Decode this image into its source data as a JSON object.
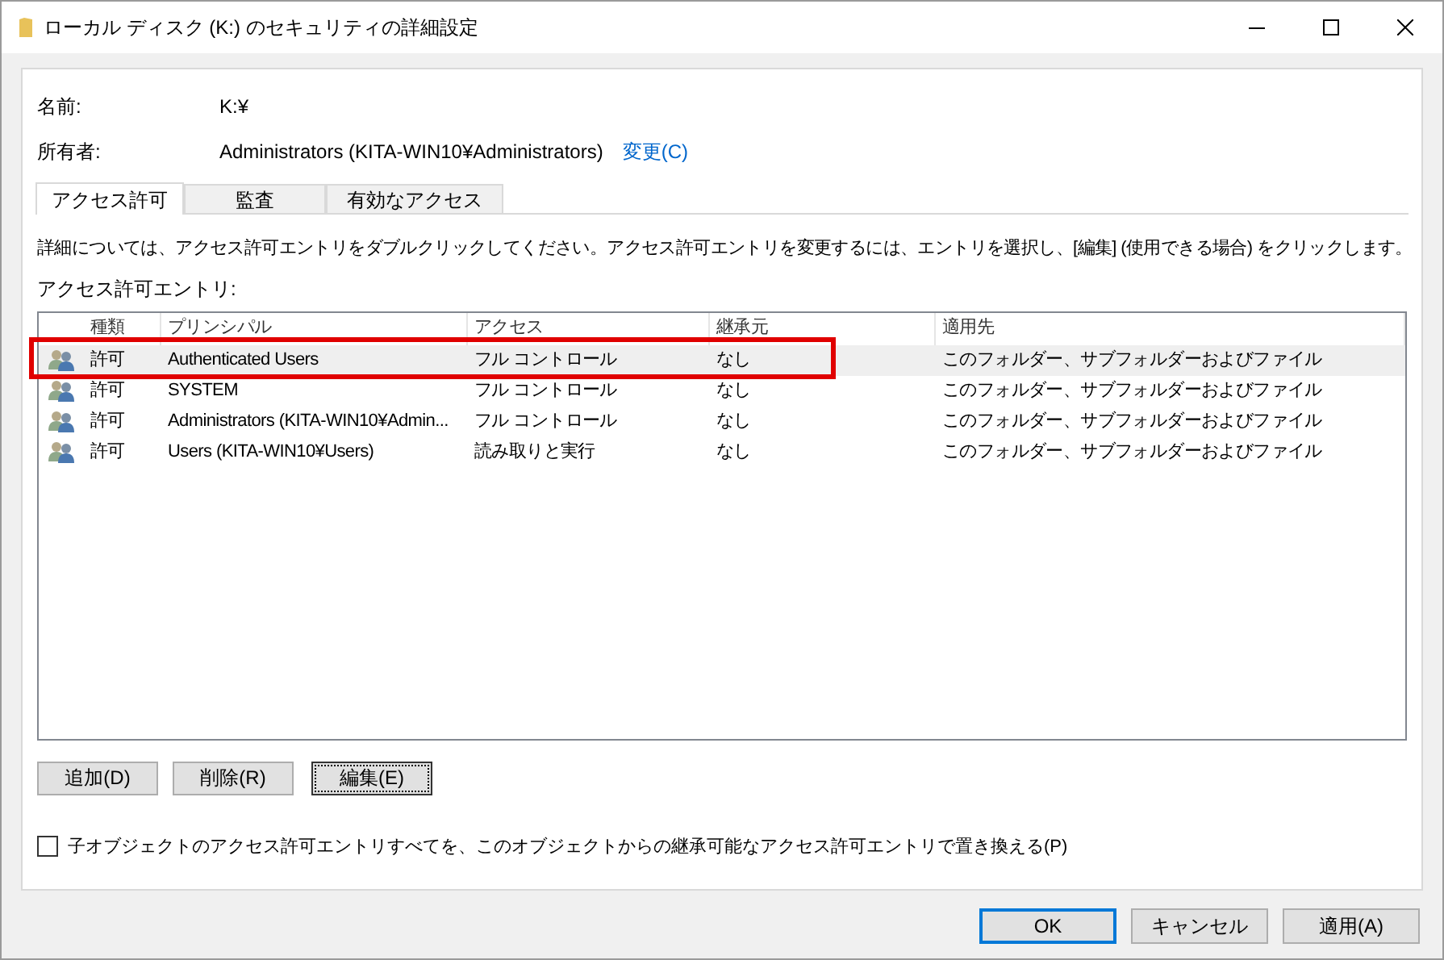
{
  "window": {
    "title": "ローカル ディスク (K:) のセキュリティの詳細設定"
  },
  "fields": [
    {
      "label": "名前:",
      "value": "K:¥"
    },
    {
      "label": "所有者:",
      "value": "Administrators (KITA-WIN10¥Administrators)",
      "link": "変更(C)"
    }
  ],
  "tabs": [
    {
      "label": "アクセス許可",
      "selected": true
    },
    {
      "label": "監査",
      "selected": false
    },
    {
      "label": "有効なアクセス",
      "selected": false
    }
  ],
  "description": "詳細については、アクセス許可エントリをダブルクリックしてください。アクセス許可エントリを変更するには、エントリを選択し、[編集] (使用できる場合) をクリックします。",
  "list_label": "アクセス許可エントリ:",
  "table": {
    "columns": [
      "種類",
      "プリンシパル",
      "アクセス",
      "継承元",
      "適用先"
    ],
    "rows": [
      {
        "cells": [
          "許可",
          "Authenticated Users",
          "フル コントロール",
          "なし",
          "このフォルダー、サブフォルダーおよびファイル"
        ],
        "selected": true,
        "highlighted": true
      },
      {
        "cells": [
          "許可",
          "SYSTEM",
          "フル コントロール",
          "なし",
          "このフォルダー、サブフォルダーおよびファイル"
        ],
        "selected": false,
        "highlighted": false
      },
      {
        "cells": [
          "許可",
          "Administrators (KITA-WIN10¥Admin...",
          "フル コントロール",
          "なし",
          "このフォルダー、サブフォルダーおよびファイル"
        ],
        "selected": false,
        "highlighted": false
      },
      {
        "cells": [
          "許可",
          "Users (KITA-WIN10¥Users)",
          "読み取りと実行",
          "なし",
          "このフォルダー、サブフォルダーおよびファイル"
        ],
        "selected": false,
        "highlighted": false
      }
    ]
  },
  "entry_buttons": [
    {
      "label": "追加(D)",
      "focused": false
    },
    {
      "label": "削除(R)",
      "focused": false
    },
    {
      "label": "編集(E)",
      "focused": true
    }
  ],
  "replace_checkbox": {
    "label": "子オブジェクトのアクセス許可エントリすべてを、このオブジェクトからの継承可能なアクセス許可エントリで置き換える(P)",
    "checked": false
  },
  "dialog_buttons": [
    {
      "label": "OK",
      "default": true
    },
    {
      "label": "キャンセル",
      "default": false
    },
    {
      "label": "適用(A)",
      "default": false
    }
  ]
}
